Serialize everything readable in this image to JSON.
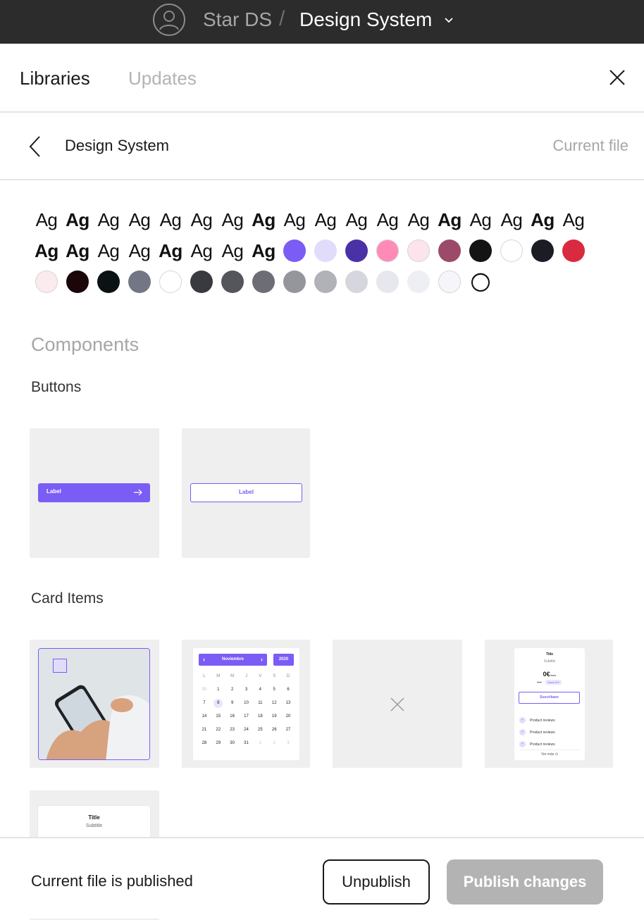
{
  "topbar": {
    "project": "Star DS",
    "separator": "/",
    "file_name": "Design System"
  },
  "tabs": [
    {
      "label": "Libraries",
      "active": true
    },
    {
      "label": "Updates",
      "active": false
    }
  ],
  "library": {
    "name": "Design System",
    "badge": "Current file"
  },
  "text_styles": [
    {
      "label": "Ag",
      "bold": false
    },
    {
      "label": "Ag",
      "bold": true
    },
    {
      "label": "Ag",
      "bold": false
    },
    {
      "label": "Ag",
      "bold": false
    },
    {
      "label": "Ag",
      "bold": false
    },
    {
      "label": "Ag",
      "bold": false
    },
    {
      "label": "Ag",
      "bold": false
    },
    {
      "label": "Ag",
      "bold": true
    },
    {
      "label": "Ag",
      "bold": false
    },
    {
      "label": "Ag",
      "bold": false
    },
    {
      "label": "Ag",
      "bold": false
    },
    {
      "label": "Ag",
      "bold": false
    },
    {
      "label": "Ag",
      "bold": false
    },
    {
      "label": "Ag",
      "bold": true
    },
    {
      "label": "Ag",
      "bold": false
    },
    {
      "label": "Ag",
      "bold": false
    },
    {
      "label": "Ag",
      "bold": true
    },
    {
      "label": "Ag",
      "bold": false
    },
    {
      "label": "Ag",
      "bold": true
    },
    {
      "label": "Ag",
      "bold": true
    },
    {
      "label": "Ag",
      "bold": false
    },
    {
      "label": "Ag",
      "bold": false
    },
    {
      "label": "Ag",
      "bold": true
    },
    {
      "label": "Ag",
      "bold": false
    },
    {
      "label": "Ag",
      "bold": false
    },
    {
      "label": "Ag",
      "bold": true
    }
  ],
  "color_styles": [
    "#7b5cf5",
    "#e2dcfb",
    "#4a32a6",
    "#ff8ab8",
    "#fde4ec",
    "#9b4a6a",
    "#141414",
    "#ffffff",
    "#1c1d24",
    "#d92a40",
    "#fbeaee",
    "#1b0609",
    "#0b1214",
    "#737684",
    "#ffffff",
    "#393a40",
    "#55565c",
    "#6d6e75",
    "#95969c",
    "#b1b2b8",
    "#d6d7de",
    "#e7e7ee",
    "#eeeef5",
    "#f5f5fb"
  ],
  "effect_styles": [
    "effect-icon"
  ],
  "components": {
    "section_title": "Components",
    "groups": [
      {
        "title": "Buttons"
      },
      {
        "title": "Card Items"
      }
    ],
    "button_primary_label": "Label",
    "button_outline_label": "Label",
    "calendar": {
      "month": "Noviembre",
      "year": "2020",
      "weekdays": [
        "L",
        "M",
        "M",
        "J",
        "V",
        "S",
        "D"
      ],
      "days": [
        {
          "d": "30",
          "muted": true
        },
        {
          "d": "1"
        },
        {
          "d": "2"
        },
        {
          "d": "3"
        },
        {
          "d": "4"
        },
        {
          "d": "5"
        },
        {
          "d": "6"
        },
        {
          "d": "7"
        },
        {
          "d": "8",
          "today": true
        },
        {
          "d": "9"
        },
        {
          "d": "10"
        },
        {
          "d": "11"
        },
        {
          "d": "12"
        },
        {
          "d": "13"
        },
        {
          "d": "14"
        },
        {
          "d": "15"
        },
        {
          "d": "16"
        },
        {
          "d": "17"
        },
        {
          "d": "18"
        },
        {
          "d": "19"
        },
        {
          "d": "20"
        },
        {
          "d": "21"
        },
        {
          "d": "22"
        },
        {
          "d": "23"
        },
        {
          "d": "24"
        },
        {
          "d": "25"
        },
        {
          "d": "26"
        },
        {
          "d": "27"
        },
        {
          "d": "28"
        },
        {
          "d": "29"
        },
        {
          "d": "30"
        },
        {
          "d": "31"
        },
        {
          "d": "1",
          "muted": true
        },
        {
          "d": "2",
          "muted": true
        },
        {
          "d": "3",
          "muted": true
        }
      ]
    },
    "subscription_card": {
      "title": "Title",
      "subtitle": "Subtitle",
      "price": "0€",
      "price_unit": "/mes",
      "old_price": "99€",
      "tag": "Gana 0%",
      "cta": "Suscribase",
      "features": [
        "Product reviews",
        "Product reviews",
        "Product reviews"
      ],
      "more": "Ver más"
    },
    "small_card": {
      "title": "Title",
      "subtitle": "Subtitle"
    }
  },
  "footer": {
    "status": "Current file is published",
    "unpublish_label": "Unpublish",
    "publish_label": "Publish changes"
  }
}
